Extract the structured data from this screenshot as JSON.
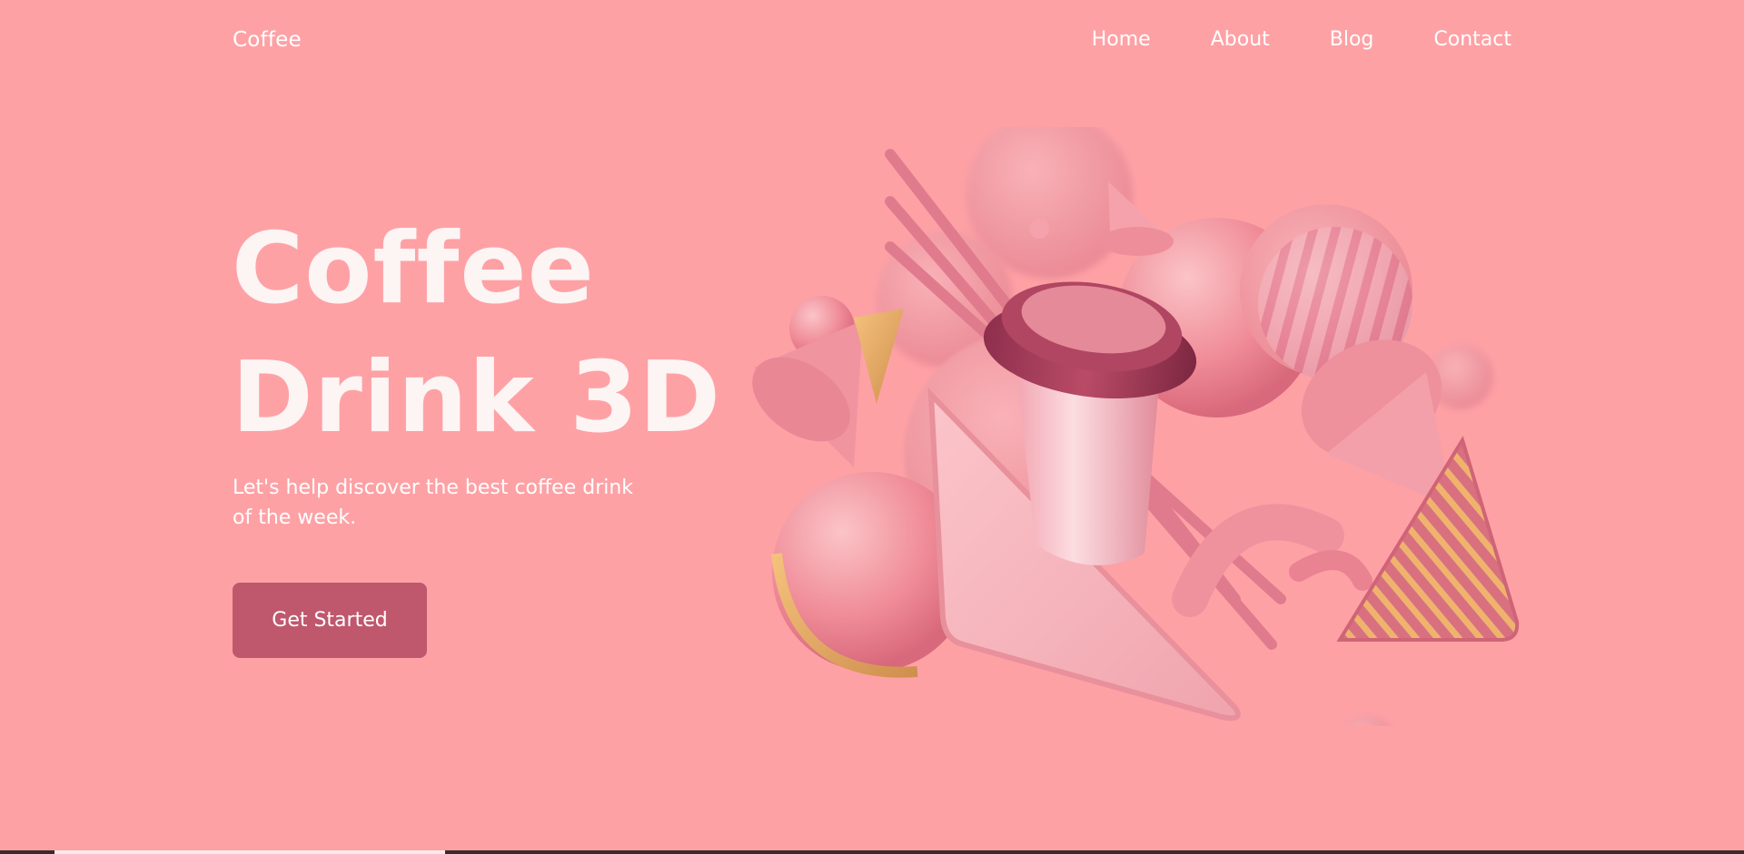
{
  "header": {
    "logo": "Coffee",
    "nav": [
      "Home",
      "About",
      "Blog",
      "Contact"
    ]
  },
  "hero": {
    "title_line1": "Coffee",
    "title_line2": "Drink 3D",
    "subtitle": "Let's help discover the best coffee drink of the week.",
    "cta_label": "Get Started"
  },
  "illustration": {
    "description_icon": "coffee-cup-3d-shapes-illustration"
  },
  "colors": {
    "background": "#fea1a5",
    "button": "#c0586d",
    "text": "#ffffff"
  }
}
